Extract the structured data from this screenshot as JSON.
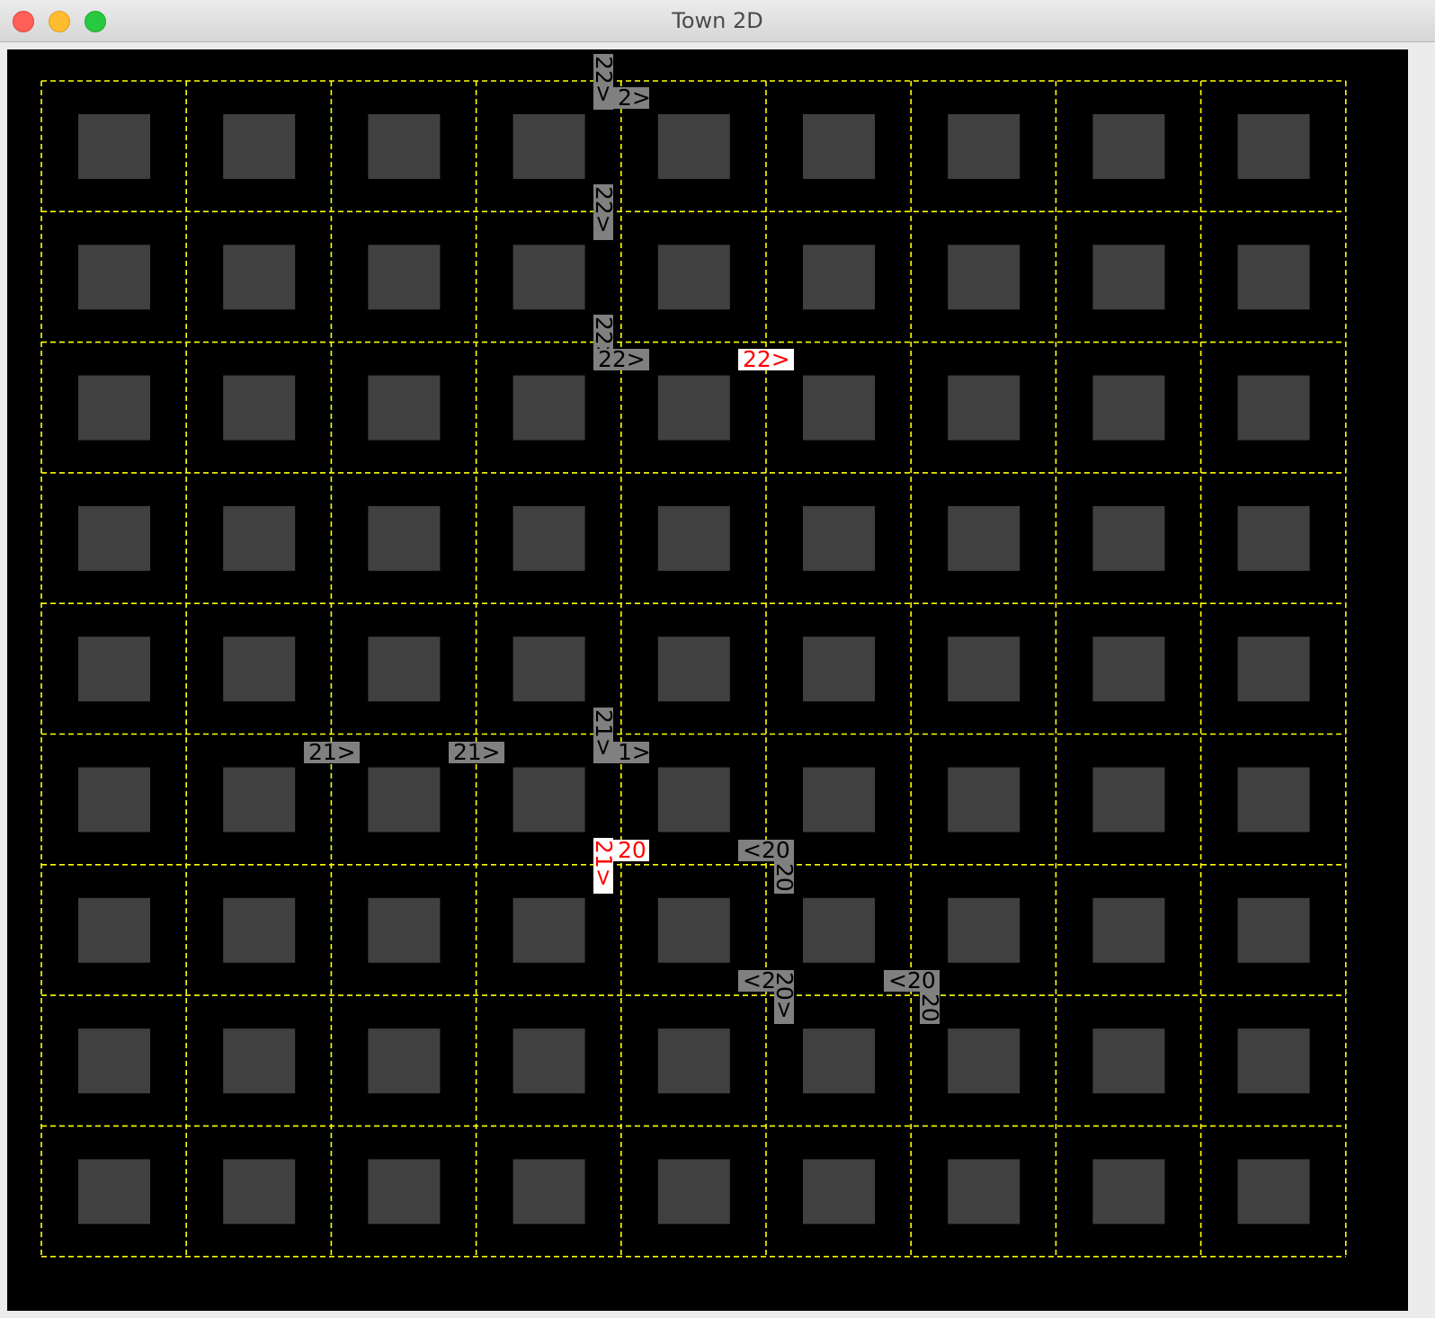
{
  "window": {
    "title": "Town 2D",
    "buttons": [
      "close",
      "minimize",
      "maximize"
    ]
  },
  "town": {
    "rows": 9,
    "cols": 9,
    "colors": {
      "background": "#000000",
      "building": "#404040",
      "grid_line": "#ffff00",
      "car_label_bg": "#808080",
      "car_label_text": "#000000",
      "highlight_label_bg": "#ffffff",
      "highlight_label_text": "#ff0000"
    },
    "car_labels": [
      {
        "text": "22>",
        "orientation": "vertical",
        "highlight": false
      },
      {
        "text": "2>",
        "orientation": "horizontal",
        "highlight": false
      },
      {
        "text": "22>",
        "orientation": "vertical",
        "highlight": false
      },
      {
        "text": "22>",
        "orientation": "vertical",
        "highlight": false
      },
      {
        "text": "22>",
        "orientation": "horizontal",
        "highlight": false
      },
      {
        "text": "22>",
        "orientation": "horizontal",
        "highlight": true
      },
      {
        "text": "21>",
        "orientation": "horizontal",
        "highlight": false
      },
      {
        "text": "21>",
        "orientation": "horizontal",
        "highlight": false
      },
      {
        "text": "21>",
        "orientation": "vertical",
        "highlight": false
      },
      {
        "text": "1>",
        "orientation": "horizontal",
        "highlight": false
      },
      {
        "text": "21>",
        "orientation": "vertical",
        "highlight": true
      },
      {
        "text": "20",
        "orientation": "horizontal",
        "highlight": true
      },
      {
        "text": "<20",
        "orientation": "horizontal",
        "highlight": false
      },
      {
        "text": "20",
        "orientation": "vertical",
        "highlight": false
      },
      {
        "text": "<2",
        "orientation": "horizontal",
        "highlight": false
      },
      {
        "text": "20>",
        "orientation": "vertical",
        "highlight": false
      },
      {
        "text": "<20",
        "orientation": "horizontal",
        "highlight": false
      },
      {
        "text": "20",
        "orientation": "vertical",
        "highlight": false
      }
    ]
  }
}
